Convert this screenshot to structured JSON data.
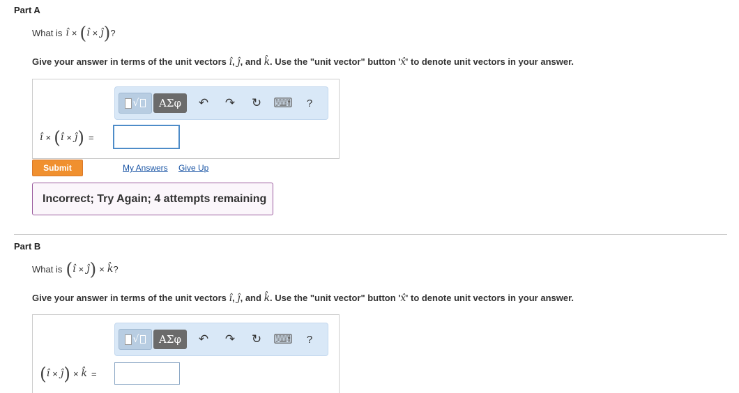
{
  "part_a": {
    "title": "Part A",
    "question_prefix": "What is",
    "question_suffix": "?",
    "instructions_prefix": "Give your answer in terms of the unit vectors",
    "instructions_and": "and",
    "instructions_suffix": ". Use the \"unit vector\" button '",
    "instructions_end": "' to denote unit vectors in your answer.",
    "unit_vector_glyph": "x̂",
    "eq_sign": "=",
    "answer_value": "",
    "submit_label": "Submit",
    "my_answers_label": "My Answers",
    "give_up_label": "Give Up",
    "feedback": "Incorrect; Try Again; 4 attempts remaining"
  },
  "part_b": {
    "title": "Part B",
    "question_prefix": "What is",
    "question_suffix": "?",
    "instructions_prefix": "Give your answer in terms of the unit vectors",
    "instructions_and": "and",
    "instructions_suffix": ". Use the \"unit vector\" button '",
    "instructions_end": "' to denote unit vectors in your answer.",
    "unit_vector_glyph": "x̂",
    "eq_sign": "=",
    "answer_value": ""
  },
  "symbols": {
    "i_hat": "î",
    "j_hat": "ĵ",
    "k_hat": "k̂",
    "times": "×",
    "lparen": "(",
    "rparen": ")",
    "comma": ","
  },
  "toolbar": {
    "greek_label": "ΑΣφ",
    "sqrt_glyph": "√",
    "undo_icon": "↶",
    "redo_icon": "↷",
    "reset_icon": "↻",
    "keyboard_icon": "⌨",
    "help_label": "?"
  },
  "colors": {
    "toolbar_bg": "#d9e8f7",
    "submit_bg": "#f0902f",
    "link": "#1a55a5",
    "feedback_border": "#9a5b9e"
  }
}
